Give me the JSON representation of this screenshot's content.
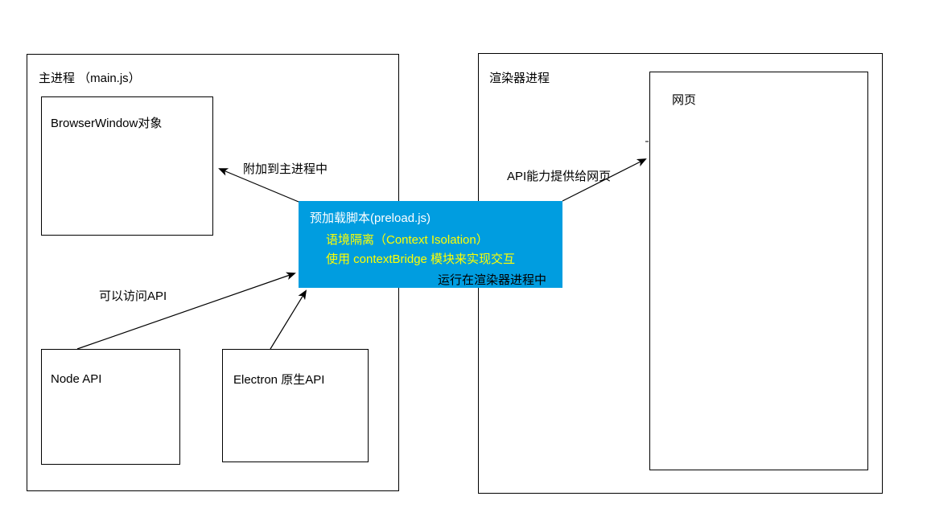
{
  "main_process": {
    "title": "主进程 （main.js）",
    "browser_window": "BrowserWindow对象",
    "node_api": "Node API",
    "electron_api": "Electron 原生API",
    "api_access_label": "可以访问API"
  },
  "renderer_process": {
    "title": "渲染器进程",
    "webpage": "网页"
  },
  "preload": {
    "title": "预加载脚本(preload.js)",
    "isolation": "语境隔离（Context Isolation）",
    "bridge": "使用 contextBridge 模块来实现交互",
    "runs_in": "运行在渲染器进程中"
  },
  "arrows": {
    "attach_to_main": "附加到主进程中",
    "api_to_webpage": "API能力提供给网页"
  },
  "colors": {
    "preload_bg": "#009de0",
    "preload_yellow": "#ffff00"
  }
}
